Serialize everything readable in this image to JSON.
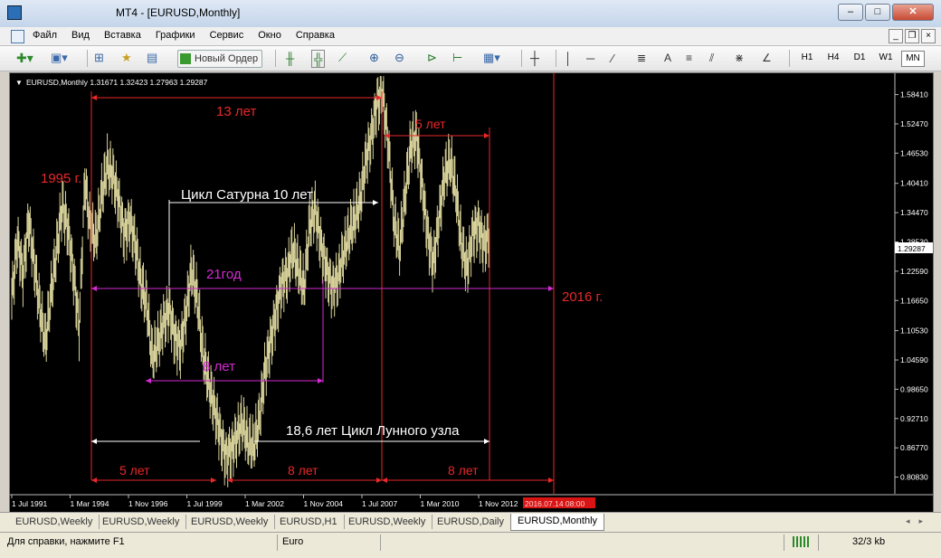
{
  "window": {
    "title": "MT4 - [EURUSD,Monthly]"
  },
  "menu": {
    "items": [
      "Файл",
      "Вид",
      "Вставка",
      "Графики",
      "Сервис",
      "Окно",
      "Справка"
    ]
  },
  "toolbar": {
    "new_order": "Новый Ордер",
    "timeframes": [
      "H1",
      "H4",
      "D1",
      "W1",
      "MN"
    ],
    "active_timeframe": "MN"
  },
  "chart": {
    "header": "EURUSD,Monthly  1.31671 1.32423 1.27963 1.29287",
    "current_price": "1.29287",
    "price_labels": [
      "1.58410",
      "1.52470",
      "1.46530",
      "1.40410",
      "1.34470",
      "1.28530",
      "1.22590",
      "1.16650",
      "1.10530",
      "1.04590",
      "0.98650",
      "0.92710",
      "0.86770",
      "0.80830"
    ],
    "date_labels": [
      "1 Jul 1991",
      "1 Mar 1994",
      "1 Nov 1996",
      "1 Jul 1999",
      "1 Mar 2002",
      "1 Nov 2004",
      "1 Jul 2007",
      "1 Mar 2010",
      "1 Nov 2012"
    ],
    "cursor_date": "2016.07.14 08:00",
    "annotations": [
      "13 лет",
      "5 лет",
      "1995 г.",
      "Цикл Сатурна 10 лет",
      "21год",
      "2016 г.",
      "8 лет",
      "18,6 лет Цикл Лунного узла",
      "5 лет",
      "8 лет",
      "8 лет"
    ],
    "colors": {
      "background": "#000000",
      "bars": "#d8d29a",
      "red": "#e8282a",
      "magenta": "#d42ad4",
      "white": "#ffffff"
    }
  },
  "chart_data": {
    "type": "bar",
    "title": "EURUSD,Monthly",
    "ylim": [
      0.78,
      1.62
    ],
    "series": [
      {
        "name": "EURUSD",
        "values": [
          1.17,
          1.29,
          1.22,
          1.33,
          1.24,
          1.15,
          1.08,
          1.18,
          1.27,
          1.36,
          1.31,
          1.22,
          1.11,
          1.41,
          1.31,
          1.29,
          1.38,
          1.44,
          1.42,
          1.37,
          1.3,
          1.33,
          1.28,
          1.2,
          1.16,
          1.05,
          1.08,
          1.12,
          1.15,
          1.09,
          1.07,
          1.14,
          1.23,
          1.17,
          1.06,
          1.0,
          0.95,
          0.9,
          0.85,
          0.86,
          0.89,
          0.92,
          0.88,
          0.87,
          0.92,
          1.02,
          1.08,
          1.14,
          1.2,
          1.22,
          1.27,
          1.23,
          1.19,
          1.32,
          1.35,
          1.28,
          1.23,
          1.19,
          1.21,
          1.26,
          1.3,
          1.33,
          1.37,
          1.45,
          1.5,
          1.57,
          1.58,
          1.48,
          1.33,
          1.27,
          1.38,
          1.48,
          1.5,
          1.4,
          1.3,
          1.24,
          1.33,
          1.42,
          1.45,
          1.39,
          1.28,
          1.23,
          1.3,
          1.32,
          1.28,
          1.3
        ]
      }
    ],
    "x_labels": [
      "1 Jul 1991",
      "1 Mar 1994",
      "1 Nov 1996",
      "1 Jul 1999",
      "1 Mar 2002",
      "1 Nov 2004",
      "1 Jul 2007",
      "1 Mar 2010",
      "1 Nov 2012"
    ],
    "grid": false
  },
  "tabs": [
    "EURUSD,Weekly",
    "EURUSD,Weekly",
    "EURUSD,Weekly",
    "EURUSD,H1",
    "EURUSD,Weekly",
    "EURUSD,Daily",
    "EURUSD,Monthly"
  ],
  "active_tab": 6,
  "status": {
    "help": "Для справки, нажмите F1",
    "profile": "Euro",
    "traffic": "32/3 kb"
  }
}
